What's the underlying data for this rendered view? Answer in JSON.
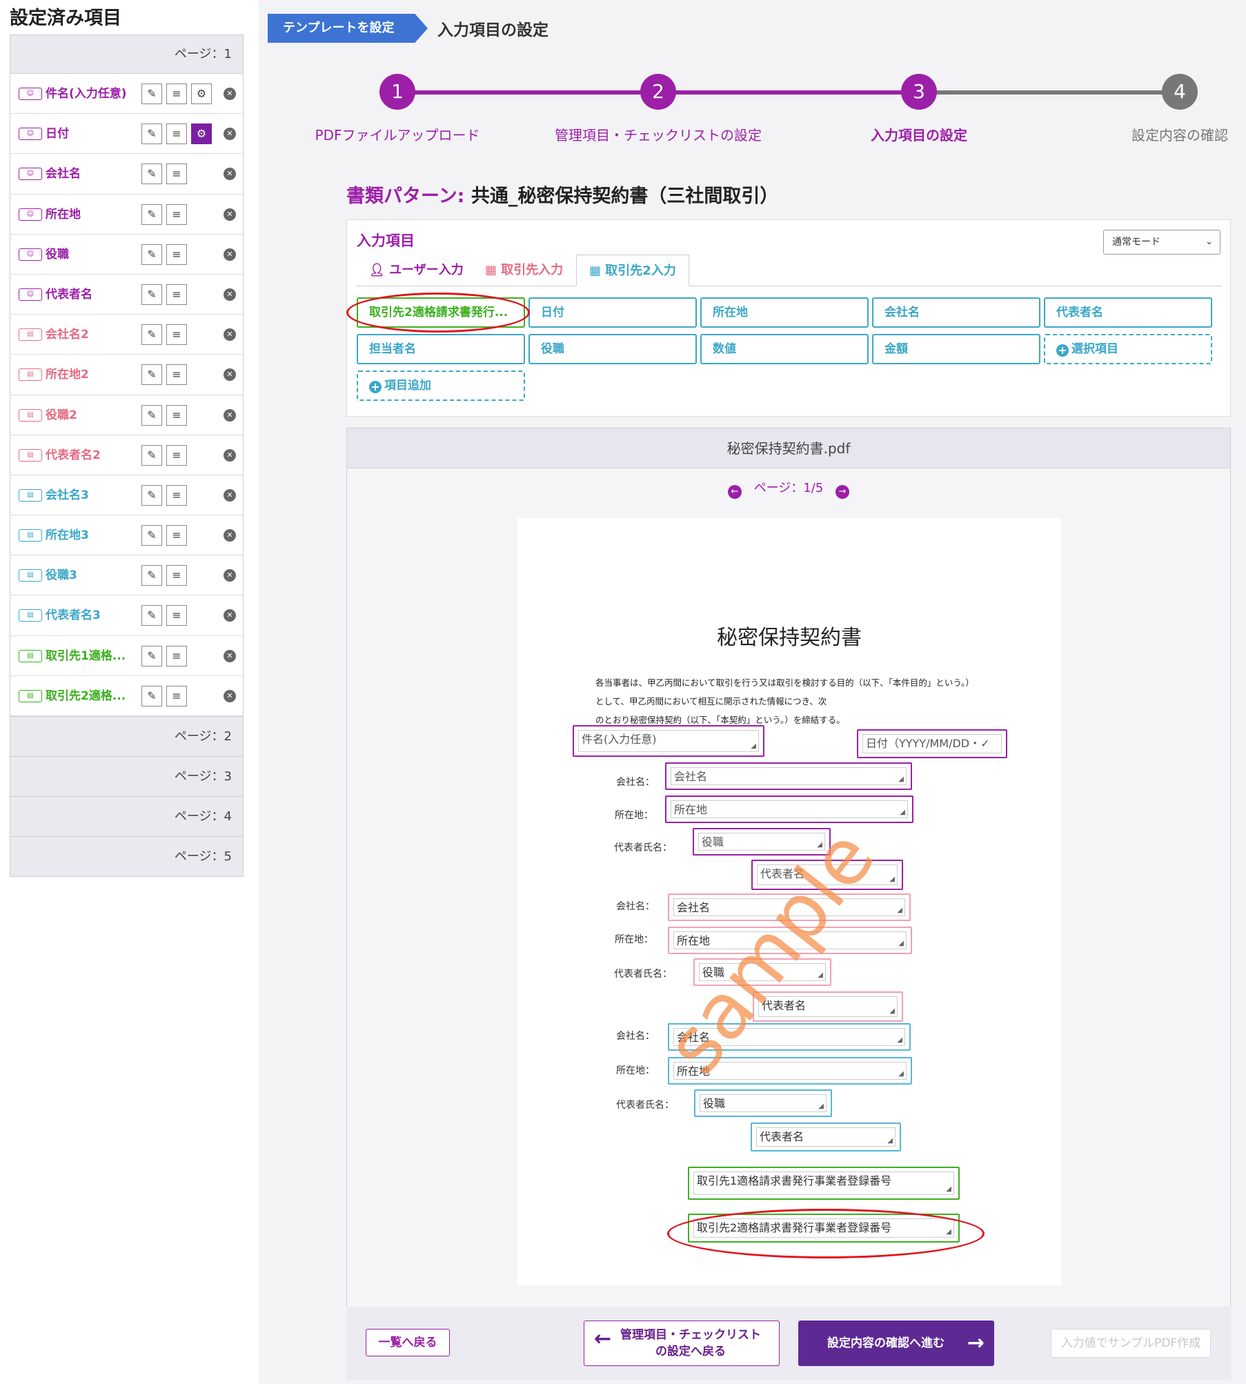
{
  "sidebar": {
    "title": "設定済み項目",
    "page1_label": "ページ：1",
    "items": [
      {
        "label": "件名(入力任意)",
        "color": "purple",
        "icon": "user-icon",
        "has_gear": true,
        "gear_active": false
      },
      {
        "label": "日付",
        "color": "purple",
        "icon": "user-icon",
        "has_gear": true,
        "gear_active": true
      },
      {
        "label": "会社名",
        "color": "purple",
        "icon": "user-icon",
        "has_gear": false
      },
      {
        "label": "所在地",
        "color": "purple",
        "icon": "user-icon",
        "has_gear": false
      },
      {
        "label": "役職",
        "color": "purple",
        "icon": "user-icon",
        "has_gear": false
      },
      {
        "label": "代表者名",
        "color": "purple",
        "icon": "user-icon",
        "has_gear": false
      },
      {
        "label": "会社名2",
        "color": "pink",
        "icon": "building-icon",
        "has_gear": false
      },
      {
        "label": "所在地2",
        "color": "pink",
        "icon": "building-icon",
        "has_gear": false
      },
      {
        "label": "役職2",
        "color": "pink",
        "icon": "building-icon",
        "has_gear": false
      },
      {
        "label": "代表者名2",
        "color": "pink",
        "icon": "building-icon",
        "has_gear": false
      },
      {
        "label": "会社名3",
        "color": "cyan",
        "icon": "building-icon",
        "has_gear": false
      },
      {
        "label": "所在地3",
        "color": "cyan",
        "icon": "building-icon",
        "has_gear": false
      },
      {
        "label": "役職3",
        "color": "cyan",
        "icon": "building-icon",
        "has_gear": false
      },
      {
        "label": "代表者名3",
        "color": "cyan",
        "icon": "building-icon",
        "has_gear": false
      },
      {
        "label": "取引先1適格...",
        "color": "green",
        "icon": "building-icon",
        "has_gear": false
      },
      {
        "label": "取引先2適格...",
        "color": "green",
        "icon": "building-icon",
        "has_gear": false
      }
    ],
    "other_pages": [
      "ページ：2",
      "ページ：3",
      "ページ：4",
      "ページ：5"
    ]
  },
  "breadcrumb": {
    "parent": "テンプレートを設定",
    "current": "入力項目の設定"
  },
  "stepper": {
    "steps": [
      {
        "number": "1",
        "label": "PDFファイルアップロード",
        "state": "done"
      },
      {
        "number": "2",
        "label": "管理項目・チェックリストの設定",
        "state": "done"
      },
      {
        "number": "3",
        "label": "入力項目の設定",
        "state": "current"
      },
      {
        "number": "4",
        "label": "設定内容の確認",
        "state": "todo"
      }
    ]
  },
  "document_pattern": {
    "key": "書類パターン:",
    "value": "共通_秘密保持契約書（三社間取引）"
  },
  "input_items": {
    "title": "入力項目",
    "mode_select": "通常モード",
    "tabs": [
      {
        "label": "ユーザー入力",
        "color": "#9c1fa8",
        "icon": "user-icon"
      },
      {
        "label": "取引先入力",
        "color": "#e56b83",
        "icon": "building-icon"
      },
      {
        "label": "取引先2入力",
        "color": "#3ba7c8",
        "icon": "building-icon",
        "active": true
      }
    ],
    "chips": [
      "取引先2適格請求書発行...",
      "日付",
      "所在地",
      "会社名",
      "代表者名",
      "担当者名",
      "役職",
      "数値",
      "金額",
      "選択項目",
      "項目追加"
    ]
  },
  "viewer": {
    "filename": "秘密保持契約書.pdf",
    "page_indicator": "ページ：1/5",
    "doc_title": "秘密保持契約書",
    "paragraph": [
      "各当事者は、甲乙丙間において取引を行う又は取引を検討する目的（以下、「本件目的」という。）",
      "として、甲乙丙間において相互に開示された情報につき、次",
      "のとおり秘密保持契約（以下、「本契約」という。）を締結する。"
    ],
    "labels": {
      "company": "会社名：",
      "address": "所在地：",
      "representative": "代表者氏名："
    },
    "fields": {
      "subject": "件名(入力任意)",
      "date": "日付（YYYY/MM/DD・✓",
      "company": "会社名",
      "address": "所在地",
      "position": "役職",
      "rep": "代表者名",
      "reg1": "取引先1適格請求書発行事業者登録番号",
      "reg2": "取引先2適格請求書発行事業者登録番号"
    },
    "watermark": "sample"
  },
  "footer": {
    "back_to_list": "一覧へ戻る",
    "prev_line1": "管理項目・チェックリスト",
    "prev_line2": "の設定へ戻る",
    "next": "設定内容の確認へ進む",
    "sample_pdf": "入力値でサンプルPDF作成"
  },
  "colors": {
    "purple": "#9c1fa8",
    "pink": "#e56b83",
    "cyan": "#3ba7c8",
    "green": "#3bb01f",
    "primary_button": "#5d2a93",
    "breadcrumb_blue": "#3d74d3"
  }
}
